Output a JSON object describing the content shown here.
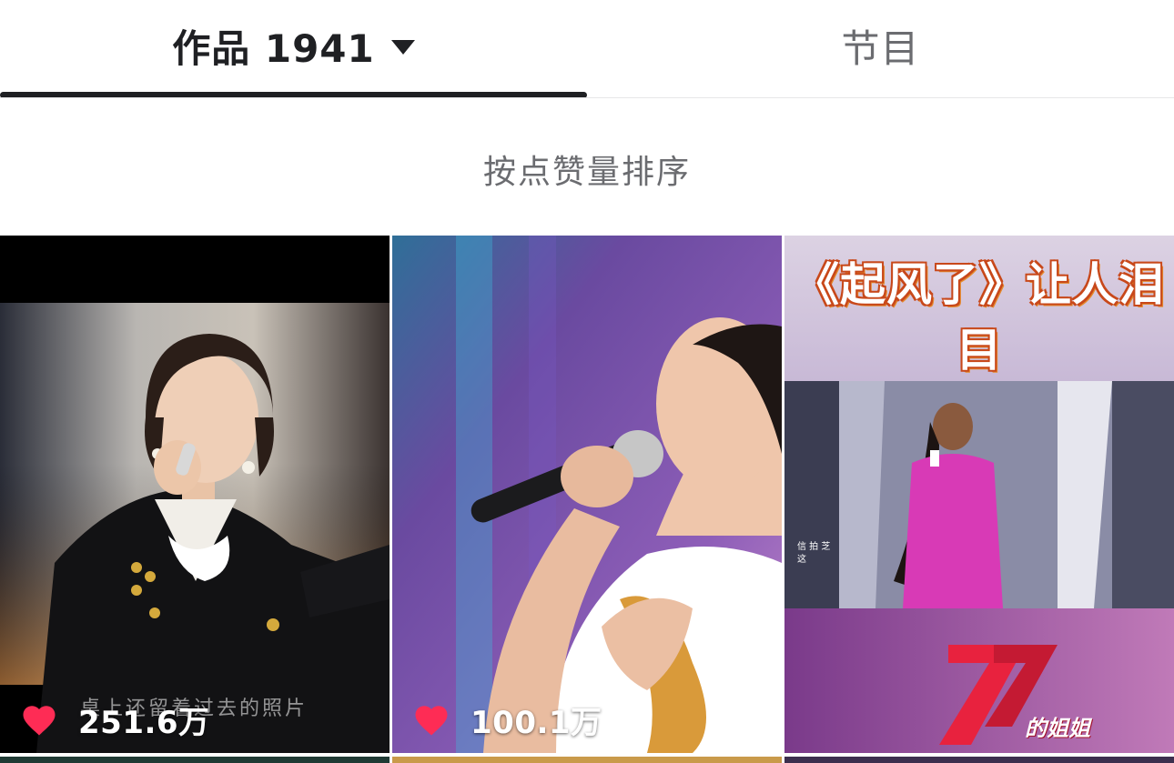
{
  "tabs": {
    "works": {
      "label": "作品 1941",
      "active": true
    },
    "shows": {
      "label": "节目"
    }
  },
  "sort": {
    "label": "按点赞量排序"
  },
  "grid": {
    "items": [
      {
        "likes": "251.6万",
        "caption": "桌上还留着过去的照片",
        "icon": "heart-icon"
      },
      {
        "likes": "100.1万",
        "icon": "heart-icon"
      },
      {
        "banner": "《起风了》让人泪目",
        "logo_text": "的姐姐",
        "lyric": "信 拍 芝\n这"
      }
    ]
  },
  "colors": {
    "active_text": "#1f2023",
    "inactive_text": "#6b6c70",
    "heart": "#fe2c55"
  }
}
